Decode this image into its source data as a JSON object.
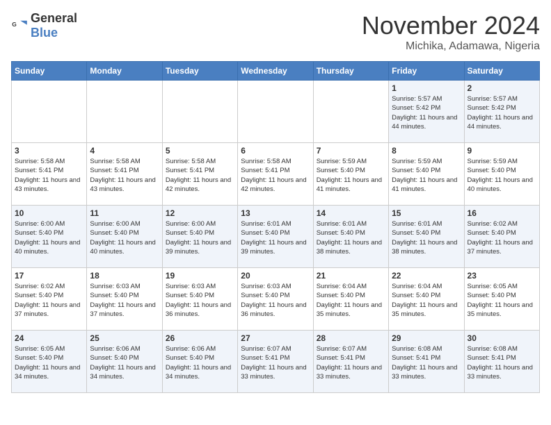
{
  "header": {
    "logo": {
      "general": "General",
      "blue": "Blue"
    },
    "month": "November 2024",
    "location": "Michika, Adamawa, Nigeria"
  },
  "weekdays": [
    "Sunday",
    "Monday",
    "Tuesday",
    "Wednesday",
    "Thursday",
    "Friday",
    "Saturday"
  ],
  "weeks": [
    [
      {
        "day": "",
        "info": ""
      },
      {
        "day": "",
        "info": ""
      },
      {
        "day": "",
        "info": ""
      },
      {
        "day": "",
        "info": ""
      },
      {
        "day": "",
        "info": ""
      },
      {
        "day": "1",
        "info": "Sunrise: 5:57 AM\nSunset: 5:42 PM\nDaylight: 11 hours and 44 minutes."
      },
      {
        "day": "2",
        "info": "Sunrise: 5:57 AM\nSunset: 5:42 PM\nDaylight: 11 hours and 44 minutes."
      }
    ],
    [
      {
        "day": "3",
        "info": "Sunrise: 5:58 AM\nSunset: 5:41 PM\nDaylight: 11 hours and 43 minutes."
      },
      {
        "day": "4",
        "info": "Sunrise: 5:58 AM\nSunset: 5:41 PM\nDaylight: 11 hours and 43 minutes."
      },
      {
        "day": "5",
        "info": "Sunrise: 5:58 AM\nSunset: 5:41 PM\nDaylight: 11 hours and 42 minutes."
      },
      {
        "day": "6",
        "info": "Sunrise: 5:58 AM\nSunset: 5:41 PM\nDaylight: 11 hours and 42 minutes."
      },
      {
        "day": "7",
        "info": "Sunrise: 5:59 AM\nSunset: 5:40 PM\nDaylight: 11 hours and 41 minutes."
      },
      {
        "day": "8",
        "info": "Sunrise: 5:59 AM\nSunset: 5:40 PM\nDaylight: 11 hours and 41 minutes."
      },
      {
        "day": "9",
        "info": "Sunrise: 5:59 AM\nSunset: 5:40 PM\nDaylight: 11 hours and 40 minutes."
      }
    ],
    [
      {
        "day": "10",
        "info": "Sunrise: 6:00 AM\nSunset: 5:40 PM\nDaylight: 11 hours and 40 minutes."
      },
      {
        "day": "11",
        "info": "Sunrise: 6:00 AM\nSunset: 5:40 PM\nDaylight: 11 hours and 40 minutes."
      },
      {
        "day": "12",
        "info": "Sunrise: 6:00 AM\nSunset: 5:40 PM\nDaylight: 11 hours and 39 minutes."
      },
      {
        "day": "13",
        "info": "Sunrise: 6:01 AM\nSunset: 5:40 PM\nDaylight: 11 hours and 39 minutes."
      },
      {
        "day": "14",
        "info": "Sunrise: 6:01 AM\nSunset: 5:40 PM\nDaylight: 11 hours and 38 minutes."
      },
      {
        "day": "15",
        "info": "Sunrise: 6:01 AM\nSunset: 5:40 PM\nDaylight: 11 hours and 38 minutes."
      },
      {
        "day": "16",
        "info": "Sunrise: 6:02 AM\nSunset: 5:40 PM\nDaylight: 11 hours and 37 minutes."
      }
    ],
    [
      {
        "day": "17",
        "info": "Sunrise: 6:02 AM\nSunset: 5:40 PM\nDaylight: 11 hours and 37 minutes."
      },
      {
        "day": "18",
        "info": "Sunrise: 6:03 AM\nSunset: 5:40 PM\nDaylight: 11 hours and 37 minutes."
      },
      {
        "day": "19",
        "info": "Sunrise: 6:03 AM\nSunset: 5:40 PM\nDaylight: 11 hours and 36 minutes."
      },
      {
        "day": "20",
        "info": "Sunrise: 6:03 AM\nSunset: 5:40 PM\nDaylight: 11 hours and 36 minutes."
      },
      {
        "day": "21",
        "info": "Sunrise: 6:04 AM\nSunset: 5:40 PM\nDaylight: 11 hours and 35 minutes."
      },
      {
        "day": "22",
        "info": "Sunrise: 6:04 AM\nSunset: 5:40 PM\nDaylight: 11 hours and 35 minutes."
      },
      {
        "day": "23",
        "info": "Sunrise: 6:05 AM\nSunset: 5:40 PM\nDaylight: 11 hours and 35 minutes."
      }
    ],
    [
      {
        "day": "24",
        "info": "Sunrise: 6:05 AM\nSunset: 5:40 PM\nDaylight: 11 hours and 34 minutes."
      },
      {
        "day": "25",
        "info": "Sunrise: 6:06 AM\nSunset: 5:40 PM\nDaylight: 11 hours and 34 minutes."
      },
      {
        "day": "26",
        "info": "Sunrise: 6:06 AM\nSunset: 5:40 PM\nDaylight: 11 hours and 34 minutes."
      },
      {
        "day": "27",
        "info": "Sunrise: 6:07 AM\nSunset: 5:41 PM\nDaylight: 11 hours and 33 minutes."
      },
      {
        "day": "28",
        "info": "Sunrise: 6:07 AM\nSunset: 5:41 PM\nDaylight: 11 hours and 33 minutes."
      },
      {
        "day": "29",
        "info": "Sunrise: 6:08 AM\nSunset: 5:41 PM\nDaylight: 11 hours and 33 minutes."
      },
      {
        "day": "30",
        "info": "Sunrise: 6:08 AM\nSunset: 5:41 PM\nDaylight: 11 hours and 33 minutes."
      }
    ]
  ]
}
